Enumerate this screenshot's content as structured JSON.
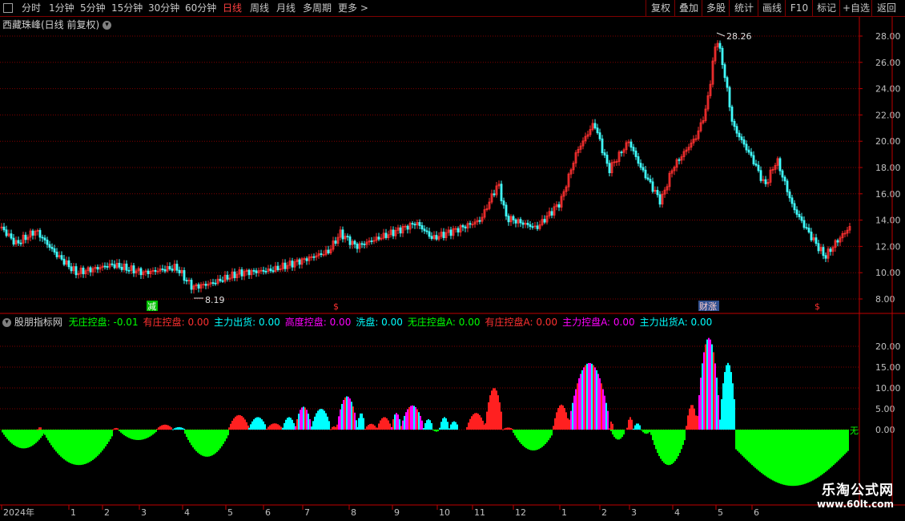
{
  "toolbar": {
    "periods": [
      "分时",
      "1分钟",
      "5分钟",
      "15分钟",
      "30分钟",
      "60分钟",
      "日线",
      "周线",
      "月线",
      "多周期",
      "更多 >"
    ],
    "active_period": "日线",
    "right_buttons": [
      "复权",
      "叠加",
      "多股",
      "统计",
      "画线",
      "F10",
      "标记",
      "+自选",
      "返回"
    ]
  },
  "main_chart": {
    "title": "西藏珠峰(日线 前复权)",
    "y_ticks": [
      "28.00",
      "26.00",
      "24.00",
      "22.00",
      "20.00",
      "18.00",
      "16.00",
      "14.00",
      "12.00",
      "10.00",
      "8.00"
    ],
    "high_label": "28.26",
    "low_label": "8.19",
    "markers": [
      "减",
      "$",
      "财涨",
      "$"
    ]
  },
  "indicator": {
    "title": "股朋指标网",
    "legend": [
      {
        "label": "无庄控盘:",
        "value": "-0.01",
        "color": "#00ff00"
      },
      {
        "label": "有庄控盘:",
        "value": "0.00",
        "color": "#ff3030"
      },
      {
        "label": "主力出货:",
        "value": "0.00",
        "color": "#00ffff"
      },
      {
        "label": "高度控盘:",
        "value": "0.00",
        "color": "#ff00ff"
      },
      {
        "label": "洗盘:",
        "value": "0.00",
        "color": "#00ffff"
      },
      {
        "label": "无庄控盘A:",
        "value": "0.00",
        "color": "#00ff00"
      },
      {
        "label": "有庄控盘A:",
        "value": "0.00",
        "color": "#ff3030"
      },
      {
        "label": "主力控盘A:",
        "value": "0.00",
        "color": "#ff00ff"
      },
      {
        "label": "主力出货A:",
        "value": "0.00",
        "color": "#00ffff"
      }
    ],
    "y_ticks": [
      "20.00",
      "15.00",
      "10.00",
      "5.00",
      "0.00"
    ],
    "edge_label": "无"
  },
  "x_axis": {
    "labels": [
      "2024年",
      "1",
      "2",
      "3",
      "4",
      "5",
      "6",
      "7",
      "8",
      "9",
      "10",
      "11",
      "12",
      "1",
      "2",
      "3",
      "4",
      "5",
      "6"
    ]
  },
  "watermark": {
    "line1": "乐淘公式网",
    "line2": "www.60lt.com"
  },
  "colors": {
    "up": "#ff3030",
    "down": "#40ffff",
    "grid": "#800000",
    "axis": "#c00000"
  }
}
